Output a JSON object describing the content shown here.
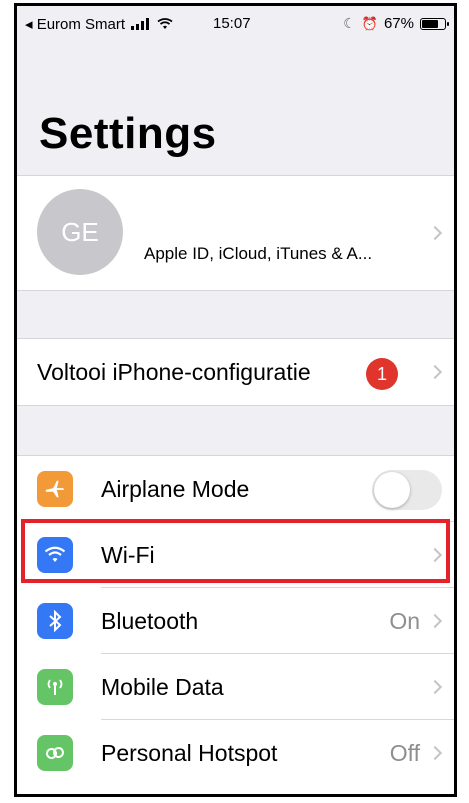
{
  "status_bar": {
    "carrier": "◂ Eurom Smart",
    "time": "15:07",
    "battery": "67%"
  },
  "page": {
    "title": "Settings"
  },
  "profile": {
    "initials": "GE",
    "subtitle": "Apple ID, iCloud, iTunes & A..."
  },
  "setup": {
    "label": "Voltooi iPhone-configuratie",
    "badge": "1"
  },
  "settings": [
    {
      "label": "Airplane Mode",
      "icon": "airplane-icon",
      "color": "#f19a37",
      "toggle": false
    },
    {
      "label": "Wi-Fi",
      "icon": "wifi-icon",
      "color": "#3478f6",
      "value": ""
    },
    {
      "label": "Bluetooth",
      "icon": "bluetooth-icon",
      "color": "#3478f6",
      "value": "On"
    },
    {
      "label": "Mobile Data",
      "icon": "antenna-icon",
      "color": "#65c466",
      "value": ""
    },
    {
      "label": "Personal Hotspot",
      "icon": "hotspot-icon",
      "color": "#65c466",
      "value": "Off"
    }
  ],
  "highlight_color": "#e3222a"
}
